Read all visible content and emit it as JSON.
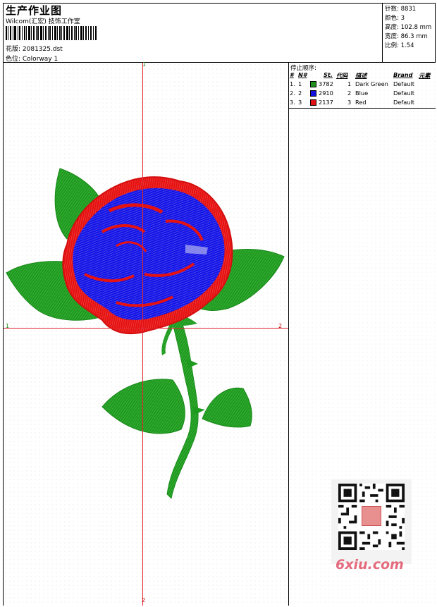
{
  "header": {
    "title": "生产作业图",
    "company": "Wilcom(汇宏) 技饰工作室",
    "file_label": "花版: 2081325.dst",
    "colorway_label": "色位: Colorway 1"
  },
  "stats": {
    "stitches": "针数: 8831",
    "colors": "颜色: 3",
    "height": "高度: 102.8 mm",
    "width": "宽度: 86.3 mm",
    "scale": "比例: 1.54"
  },
  "axes": {
    "top": "1",
    "left": "1",
    "right": "2",
    "bottom": "2"
  },
  "stop_sequence": {
    "title": "停止顺序:",
    "headers": {
      "num": "#",
      "n": "N#",
      "st": "St.",
      "code": "代码",
      "desc": "描述",
      "brand": "Brand",
      "element": "元素"
    },
    "rows": [
      {
        "num": "1.",
        "n": "1",
        "color": "#1f8f1f",
        "st": "3782",
        "code": "1",
        "desc": "Dark Green",
        "brand": "Default"
      },
      {
        "num": "2.",
        "n": "2",
        "color": "#1010e0",
        "st": "2910",
        "code": "2",
        "desc": "Blue",
        "brand": "Default"
      },
      {
        "num": "3.",
        "n": "3",
        "color": "#e01414",
        "st": "2137",
        "code": "3",
        "desc": "Red",
        "brand": "Default"
      }
    ]
  },
  "watermark": "6xiu.com"
}
